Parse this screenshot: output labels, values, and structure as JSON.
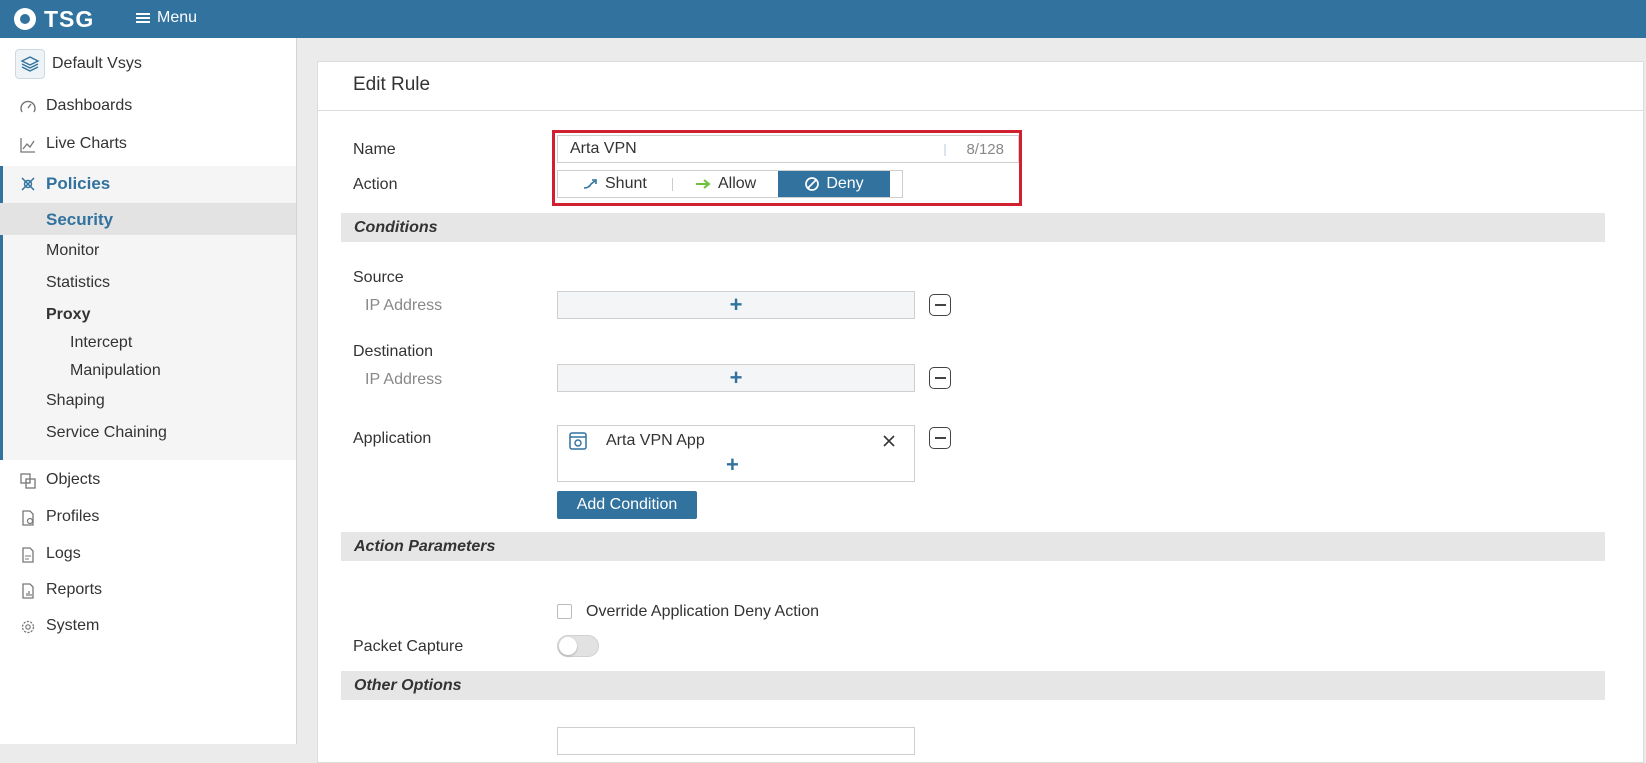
{
  "topbar": {
    "logo_text": "TSG",
    "menu_label": "Menu"
  },
  "sidebar": {
    "vsys_label": "Default Vsys",
    "items": [
      {
        "label": "Dashboards"
      },
      {
        "label": "Live Charts"
      },
      {
        "label": "Policies"
      },
      {
        "label": "Objects"
      },
      {
        "label": "Profiles"
      },
      {
        "label": "Logs"
      },
      {
        "label": "Reports"
      },
      {
        "label": "System"
      }
    ],
    "policies_sub": {
      "security": "Security",
      "monitor": "Monitor",
      "statistics": "Statistics",
      "proxy": "Proxy",
      "intercept": "Intercept",
      "manipulation": "Manipulation",
      "shaping": "Shaping",
      "service_chaining": "Service Chaining"
    }
  },
  "form": {
    "title": "Edit Rule",
    "name_label": "Name",
    "name_value": "Arta VPN",
    "name_counter": "8/128",
    "action_label": "Action",
    "action_options": {
      "shunt": "Shunt",
      "allow": "Allow",
      "deny": "Deny"
    },
    "selected_action": "Deny",
    "conditions": {
      "header": "Conditions",
      "source_label": "Source",
      "source_ip_label": "IP Address",
      "destination_label": "Destination",
      "destination_ip_label": "IP Address",
      "application_label": "Application",
      "application_value": "Arta VPN App",
      "add_condition_label": "Add Condition"
    },
    "action_parameters": {
      "header": "Action Parameters",
      "override_label": "Override Application Deny Action",
      "packet_capture_label": "Packet Capture"
    },
    "other_options": {
      "header": "Other Options"
    }
  },
  "colors": {
    "primary": "#31729e",
    "highlight": "#d1202f",
    "allow_arrow": "#6fbf3b"
  }
}
